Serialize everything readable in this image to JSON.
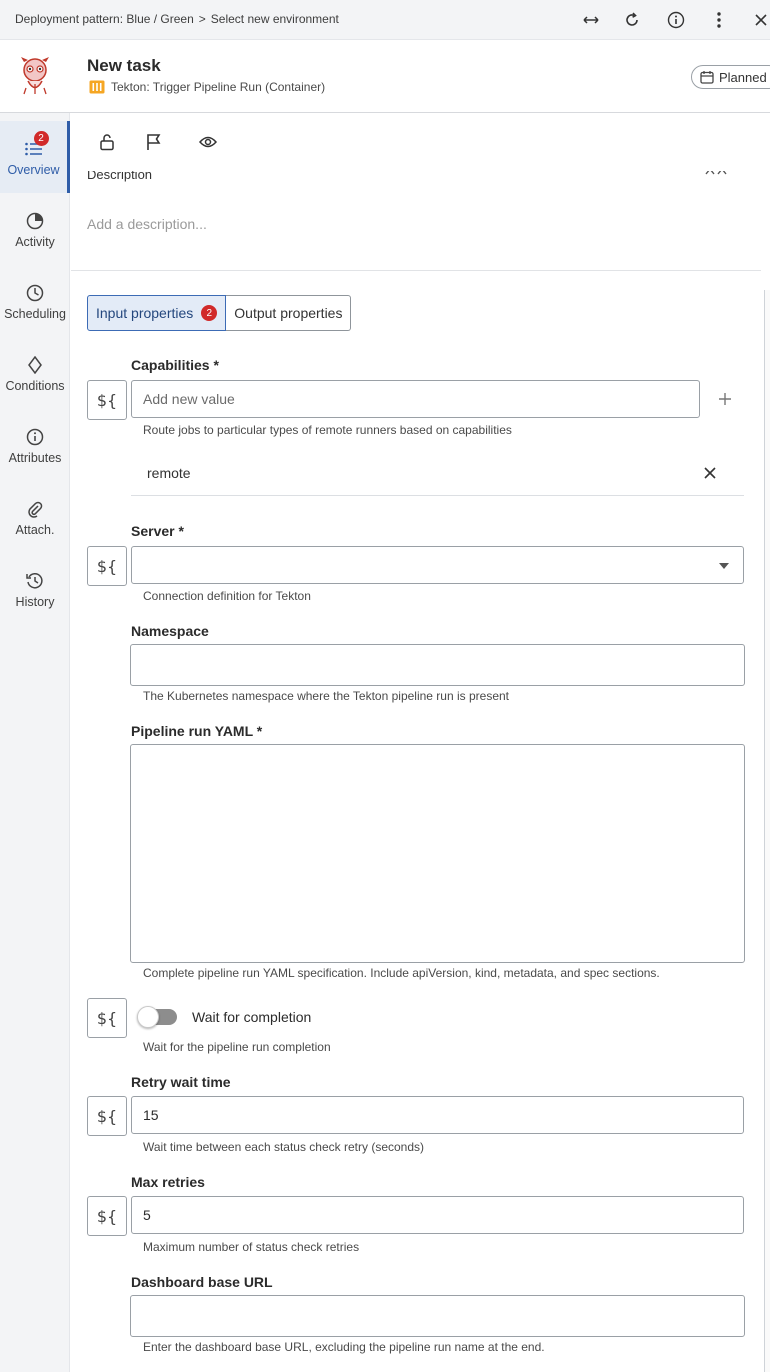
{
  "topbar": {
    "breadcrumb": [
      "Deployment pattern: Blue / Green",
      "Select new environment"
    ],
    "separator": ">",
    "icons": [
      "expand-horizontal-icon",
      "refresh-icon",
      "info-icon",
      "more-vertical-icon",
      "close-icon"
    ]
  },
  "header": {
    "title": "New task",
    "subtitle": "Tekton: Trigger Pipeline Run (Container)",
    "status": "Planned"
  },
  "leftnav": {
    "items": [
      {
        "label": "Overview",
        "icon": "list-icon",
        "badge": "2",
        "active": true
      },
      {
        "label": "Activity",
        "icon": "pie-clock-icon"
      },
      {
        "label": "Scheduling",
        "icon": "clock-icon"
      },
      {
        "label": "Conditions",
        "icon": "diamond-icon"
      },
      {
        "label": "Attributes",
        "icon": "info-circle-icon"
      },
      {
        "label": "Attach.",
        "icon": "paperclip-icon"
      },
      {
        "label": "History",
        "icon": "history-icon"
      }
    ]
  },
  "toolbar": {
    "icons": [
      "lock-open-icon",
      "flag-icon",
      "eye-icon"
    ]
  },
  "description": {
    "heading": "Description",
    "placeholder": "Add a description..."
  },
  "tabs": [
    {
      "label": "Input properties",
      "badge": "2",
      "selected": true
    },
    {
      "label": "Output properties"
    }
  ],
  "form": {
    "dollar_label": "${",
    "capabilities": {
      "label": "Capabilities *",
      "placeholder": "Add new value",
      "helper": "Route jobs to particular types of remote runners based on capabilities",
      "values": [
        "remote"
      ]
    },
    "server": {
      "label": "Server *",
      "value": "",
      "helper": "Connection definition for Tekton"
    },
    "namespace": {
      "label": "Namespace",
      "value": "",
      "helper": "The Kubernetes namespace where the Tekton pipeline run is present"
    },
    "pipeline_yaml": {
      "label": "Pipeline run YAML *",
      "value": "",
      "helper": "Complete pipeline run YAML specification. Include apiVersion, kind, metadata, and spec sections."
    },
    "wait_for_completion": {
      "label": "Wait for completion",
      "on": false,
      "helper": "Wait for the pipeline run completion"
    },
    "retry_wait_time": {
      "label": "Retry wait time",
      "value": "15",
      "helper": "Wait time between each status check retry (seconds)"
    },
    "max_retries": {
      "label": "Max retries",
      "value": "5",
      "helper": "Maximum number of status check retries"
    },
    "dashboard_url": {
      "label": "Dashboard base URL",
      "value": "",
      "helper": "Enter the dashboard base URL, excluding the pipeline run name at the end."
    }
  },
  "colors": {
    "accent": "#2f5da8",
    "badge": "#d12a2a",
    "nav_bg": "#f3f4f6"
  }
}
